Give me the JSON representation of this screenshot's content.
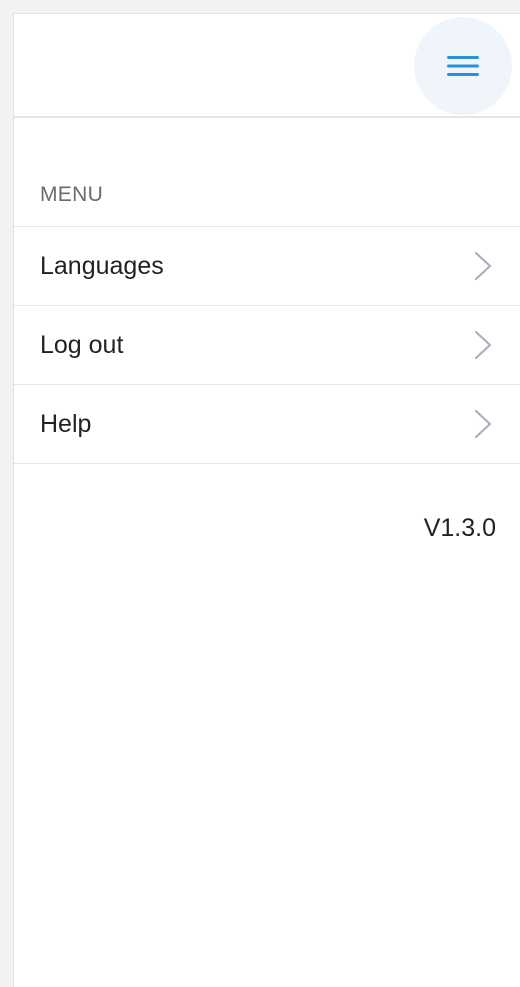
{
  "menu_toggle": {
    "icon": "hamburger-icon",
    "color": "#2a93d5"
  },
  "menu": {
    "title": "MENU",
    "items": [
      {
        "label": "Languages",
        "icon": "chevron-right-icon"
      },
      {
        "label": "Log out",
        "icon": "chevron-right-icon"
      },
      {
        "label": "Help",
        "icon": "chevron-right-icon"
      }
    ]
  },
  "version": "V1.3.0",
  "colors": {
    "accent": "#2a93d5",
    "chevron": "#a9afbf",
    "divider": "#e6e6e6"
  }
}
